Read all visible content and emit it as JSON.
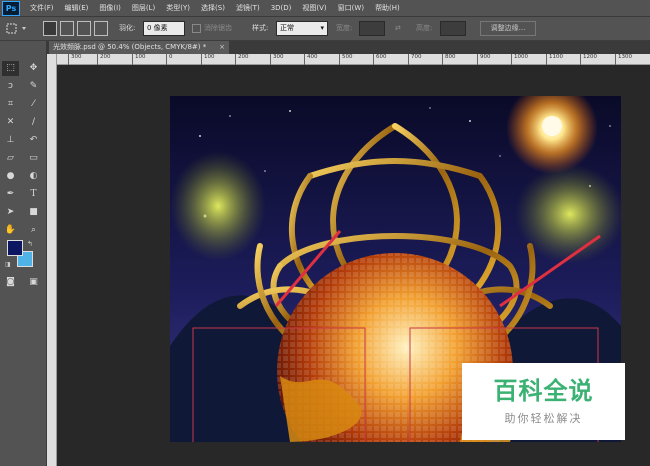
{
  "app": {
    "logo": "Ps"
  },
  "menu": [
    "文件(F)",
    "编辑(E)",
    "图像(I)",
    "图层(L)",
    "类型(Y)",
    "选择(S)",
    "滤镜(T)",
    "3D(D)",
    "视图(V)",
    "窗口(W)",
    "帮助(H)"
  ],
  "options": {
    "feather_label": "羽化:",
    "feather_value": "0 像素",
    "antialias_label": "消除锯齿",
    "style_label": "样式:",
    "style_value": "正常",
    "width_label": "宽度:",
    "height_label": "高度:",
    "refine_button": "调整边缘..."
  },
  "document": {
    "tab_title": "光效频脉.psd @ 50.4% (Objects, CMYK/8#) *",
    "close_glyph": "×"
  },
  "ruler": {
    "top_ticks": [
      "300",
      "200",
      "100",
      "0",
      "100",
      "200",
      "300",
      "400",
      "500",
      "600",
      "700",
      "800",
      "900",
      "1000",
      "1100",
      "1200",
      "1300"
    ]
  },
  "colors": {
    "foreground": "#0d1660",
    "background": "#4fb3e8",
    "accent_blue": "#31a8ff",
    "watermark_green": "#3bb273"
  },
  "tools": [
    "marquee-icon",
    "move-icon",
    "lasso-icon",
    "quick-select-icon",
    "crop-icon",
    "eyedropper-icon",
    "healing-icon",
    "brush-icon",
    "stamp-icon",
    "history-brush-icon",
    "eraser-icon",
    "gradient-icon",
    "blur-icon",
    "dodge-icon",
    "pen-icon",
    "type-icon",
    "path-select-icon",
    "shape-icon",
    "hand-icon",
    "zoom-icon",
    "quickmask-icon",
    "screen-mode-icon"
  ],
  "watermark": {
    "title": "百科全说",
    "subtitle": "助你轻松解决"
  }
}
